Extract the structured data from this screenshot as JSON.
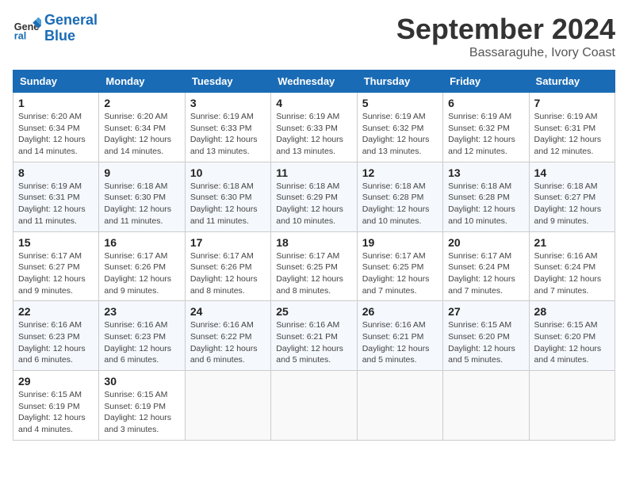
{
  "logo": {
    "text_general": "General",
    "text_blue": "Blue"
  },
  "header": {
    "month": "September 2024",
    "location": "Bassaraguhe, Ivory Coast"
  },
  "weekdays": [
    "Sunday",
    "Monday",
    "Tuesday",
    "Wednesday",
    "Thursday",
    "Friday",
    "Saturday"
  ],
  "weeks": [
    [
      {
        "day": "1",
        "sunrise": "6:20 AM",
        "sunset": "6:34 PM",
        "daylight": "12 hours and 14 minutes."
      },
      {
        "day": "2",
        "sunrise": "6:20 AM",
        "sunset": "6:34 PM",
        "daylight": "12 hours and 14 minutes."
      },
      {
        "day": "3",
        "sunrise": "6:19 AM",
        "sunset": "6:33 PM",
        "daylight": "12 hours and 13 minutes."
      },
      {
        "day": "4",
        "sunrise": "6:19 AM",
        "sunset": "6:33 PM",
        "daylight": "12 hours and 13 minutes."
      },
      {
        "day": "5",
        "sunrise": "6:19 AM",
        "sunset": "6:32 PM",
        "daylight": "12 hours and 13 minutes."
      },
      {
        "day": "6",
        "sunrise": "6:19 AM",
        "sunset": "6:32 PM",
        "daylight": "12 hours and 12 minutes."
      },
      {
        "day": "7",
        "sunrise": "6:19 AM",
        "sunset": "6:31 PM",
        "daylight": "12 hours and 12 minutes."
      }
    ],
    [
      {
        "day": "8",
        "sunrise": "6:19 AM",
        "sunset": "6:31 PM",
        "daylight": "12 hours and 11 minutes."
      },
      {
        "day": "9",
        "sunrise": "6:18 AM",
        "sunset": "6:30 PM",
        "daylight": "12 hours and 11 minutes."
      },
      {
        "day": "10",
        "sunrise": "6:18 AM",
        "sunset": "6:30 PM",
        "daylight": "12 hours and 11 minutes."
      },
      {
        "day": "11",
        "sunrise": "6:18 AM",
        "sunset": "6:29 PM",
        "daylight": "12 hours and 10 minutes."
      },
      {
        "day": "12",
        "sunrise": "6:18 AM",
        "sunset": "6:28 PM",
        "daylight": "12 hours and 10 minutes."
      },
      {
        "day": "13",
        "sunrise": "6:18 AM",
        "sunset": "6:28 PM",
        "daylight": "12 hours and 10 minutes."
      },
      {
        "day": "14",
        "sunrise": "6:18 AM",
        "sunset": "6:27 PM",
        "daylight": "12 hours and 9 minutes."
      }
    ],
    [
      {
        "day": "15",
        "sunrise": "6:17 AM",
        "sunset": "6:27 PM",
        "daylight": "12 hours and 9 minutes."
      },
      {
        "day": "16",
        "sunrise": "6:17 AM",
        "sunset": "6:26 PM",
        "daylight": "12 hours and 9 minutes."
      },
      {
        "day": "17",
        "sunrise": "6:17 AM",
        "sunset": "6:26 PM",
        "daylight": "12 hours and 8 minutes."
      },
      {
        "day": "18",
        "sunrise": "6:17 AM",
        "sunset": "6:25 PM",
        "daylight": "12 hours and 8 minutes."
      },
      {
        "day": "19",
        "sunrise": "6:17 AM",
        "sunset": "6:25 PM",
        "daylight": "12 hours and 7 minutes."
      },
      {
        "day": "20",
        "sunrise": "6:17 AM",
        "sunset": "6:24 PM",
        "daylight": "12 hours and 7 minutes."
      },
      {
        "day": "21",
        "sunrise": "6:16 AM",
        "sunset": "6:24 PM",
        "daylight": "12 hours and 7 minutes."
      }
    ],
    [
      {
        "day": "22",
        "sunrise": "6:16 AM",
        "sunset": "6:23 PM",
        "daylight": "12 hours and 6 minutes."
      },
      {
        "day": "23",
        "sunrise": "6:16 AM",
        "sunset": "6:23 PM",
        "daylight": "12 hours and 6 minutes."
      },
      {
        "day": "24",
        "sunrise": "6:16 AM",
        "sunset": "6:22 PM",
        "daylight": "12 hours and 6 minutes."
      },
      {
        "day": "25",
        "sunrise": "6:16 AM",
        "sunset": "6:21 PM",
        "daylight": "12 hours and 5 minutes."
      },
      {
        "day": "26",
        "sunrise": "6:16 AM",
        "sunset": "6:21 PM",
        "daylight": "12 hours and 5 minutes."
      },
      {
        "day": "27",
        "sunrise": "6:15 AM",
        "sunset": "6:20 PM",
        "daylight": "12 hours and 5 minutes."
      },
      {
        "day": "28",
        "sunrise": "6:15 AM",
        "sunset": "6:20 PM",
        "daylight": "12 hours and 4 minutes."
      }
    ],
    [
      {
        "day": "29",
        "sunrise": "6:15 AM",
        "sunset": "6:19 PM",
        "daylight": "12 hours and 4 minutes."
      },
      {
        "day": "30",
        "sunrise": "6:15 AM",
        "sunset": "6:19 PM",
        "daylight": "12 hours and 3 minutes."
      },
      null,
      null,
      null,
      null,
      null
    ]
  ]
}
